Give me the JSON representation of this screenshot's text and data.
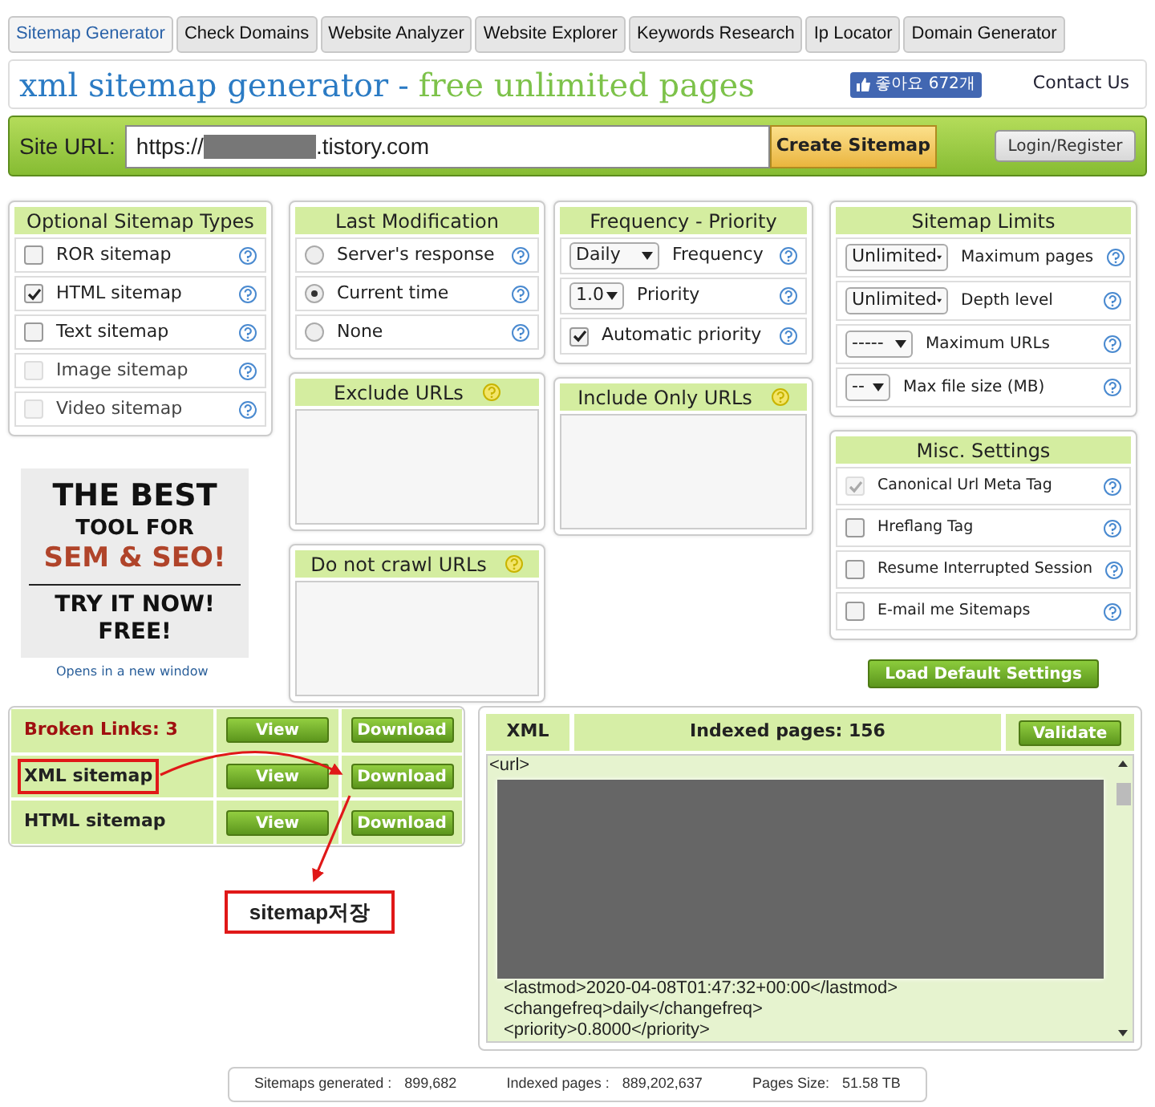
{
  "tabs": [
    {
      "label": "Sitemap Generator",
      "selected": true
    },
    {
      "label": "Check Domains",
      "selected": false
    },
    {
      "label": "Website Analyzer",
      "selected": false
    },
    {
      "label": "Website Explorer",
      "selected": false
    },
    {
      "label": "Keywords Research",
      "selected": false
    },
    {
      "label": "Ip Locator",
      "selected": false
    },
    {
      "label": "Domain Generator",
      "selected": false
    }
  ],
  "header": {
    "title": "xml sitemap generator",
    "separator": "-",
    "subtitle": "free unlimited pages",
    "like_button": "좋아요 672개",
    "contact": "Contact Us"
  },
  "url_bar": {
    "label": "Site URL:",
    "url_prefix": "https://",
    "url_suffix": ".tistory.com",
    "submit": "Create Sitemap",
    "login": "Login/Register"
  },
  "sitemap_types": {
    "title": "Optional Sitemap Types",
    "items": [
      {
        "label": "ROR sitemap",
        "checked": false,
        "disabled": false
      },
      {
        "label": "HTML sitemap",
        "checked": true,
        "disabled": false
      },
      {
        "label": "Text sitemap",
        "checked": false,
        "disabled": false
      },
      {
        "label": "Image sitemap",
        "checked": false,
        "disabled": true
      },
      {
        "label": "Video sitemap",
        "checked": false,
        "disabled": true
      }
    ]
  },
  "last_modification": {
    "title": "Last Modification",
    "options": [
      {
        "label": "Server's response",
        "selected": false
      },
      {
        "label": "Current time",
        "selected": true
      },
      {
        "label": "None",
        "selected": false
      }
    ]
  },
  "frequency_priority": {
    "title": "Frequency - Priority",
    "rows": [
      {
        "kind": "select",
        "value": "Daily",
        "label": "Frequency"
      },
      {
        "kind": "select",
        "value": "1.0",
        "label": "Priority"
      },
      {
        "kind": "checkbox",
        "label": "Automatic priority",
        "checked": true
      }
    ]
  },
  "sitemap_limits": {
    "title": "Sitemap Limits",
    "rows": [
      {
        "value": "Unlimited",
        "label": "Maximum pages"
      },
      {
        "value": "Unlimited",
        "label": "Depth level"
      },
      {
        "value": "-----",
        "label": "Maximum URLs"
      },
      {
        "value": "--",
        "label": "Max file size (MB)"
      }
    ]
  },
  "misc_settings": {
    "title": "Misc. Settings",
    "items": [
      {
        "label": "Canonical Url Meta Tag",
        "checked": true,
        "disabled": true
      },
      {
        "label": "Hreflang Tag",
        "checked": false,
        "disabled": false
      },
      {
        "label": "Resume Interrupted Session",
        "checked": false,
        "disabled": false
      },
      {
        "label": "E-mail me Sitemaps",
        "checked": false,
        "disabled": false
      }
    ]
  },
  "load_defaults": "Load Default Settings",
  "url_filters": [
    {
      "title": "Exclude URLs"
    },
    {
      "title": "Include Only URLs"
    },
    {
      "title": "Do not crawl URLs"
    }
  ],
  "ad": {
    "lines": [
      {
        "text": "THE BEST",
        "kind": "large"
      },
      {
        "text": "TOOL FOR",
        "kind": "small"
      },
      {
        "text": "SEM & SEO!",
        "kind": "accent"
      },
      {
        "text": "TRY IT NOW!",
        "kind": "medium"
      },
      {
        "text": "FREE!",
        "kind": "medium"
      }
    ],
    "caption": "Opens in a new window"
  },
  "results": {
    "rows": [
      {
        "label": "Broken Links: 3",
        "kind": "alert",
        "highlighted": false,
        "view": "View",
        "download": "Download"
      },
      {
        "label": "XML sitemap",
        "kind": "normal",
        "highlighted": true,
        "view": "View",
        "download": "Download"
      },
      {
        "label": "HTML sitemap",
        "kind": "normal",
        "highlighted": false,
        "view": "View",
        "download": "Download"
      }
    ]
  },
  "annotation": {
    "label": "sitemap저장"
  },
  "xml_view": {
    "tab": "XML",
    "indexed": "Indexed pages: 156",
    "validate": "Validate",
    "lines": [
      {
        "text": "<url>",
        "children": [
          {
            "text": "<lastmod>2020-04-08T01:47:32+00:00</lastmod>"
          },
          {
            "text": "<changefreq>daily</changefreq>"
          },
          {
            "text": "<priority>0.8000</priority>"
          }
        ]
      }
    ]
  },
  "stats": [
    {
      "label": "Sitemaps generated :",
      "value": "899,682"
    },
    {
      "label": "Indexed pages :",
      "value": "889,202,637"
    },
    {
      "label": "Pages Size:",
      "value": "51.58 TB"
    }
  ]
}
